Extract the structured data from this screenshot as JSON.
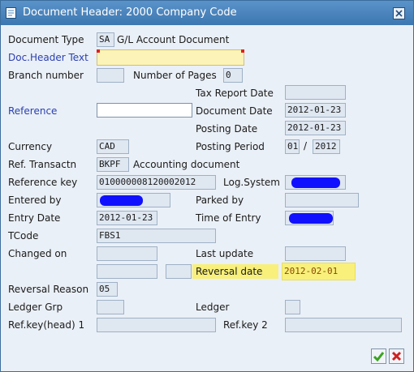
{
  "window": {
    "title": "Document Header: 2000 Company Code"
  },
  "fields": {
    "document_type": {
      "label": "Document Type",
      "code": "SA",
      "text": "G/L Account Document"
    },
    "doc_header_text": {
      "label": "Doc.Header Text",
      "value": ""
    },
    "branch_number": {
      "label": "Branch number",
      "value": ""
    },
    "number_of_pages": {
      "label": "Number of Pages",
      "value": "0"
    },
    "tax_report_date": {
      "label": "Tax Report Date",
      "value": ""
    },
    "reference": {
      "label": "Reference",
      "value": ""
    },
    "document_date": {
      "label": "Document Date",
      "value": "2012-01-23"
    },
    "posting_date": {
      "label": "Posting Date",
      "value": "2012-01-23"
    },
    "currency": {
      "label": "Currency",
      "value": "CAD"
    },
    "posting_period": {
      "label": "Posting Period",
      "period": "01",
      "separator": "/",
      "year": "2012"
    },
    "ref_transaction": {
      "label": "Ref. Transactn",
      "value": "BKPF",
      "text": "Accounting document"
    },
    "reference_key": {
      "label": "Reference key",
      "value": "010000008120002012"
    },
    "log_system": {
      "label": "Log.System",
      "value": ""
    },
    "entered_by": {
      "label": "Entered by",
      "value": ""
    },
    "parked_by": {
      "label": "Parked by",
      "value": ""
    },
    "entry_date": {
      "label": "Entry Date",
      "value": "2012-01-23"
    },
    "time_of_entry": {
      "label": "Time of Entry",
      "value": ""
    },
    "tcode": {
      "label": "TCode",
      "value": "FBS1"
    },
    "changed_on": {
      "label": "Changed on",
      "value": ""
    },
    "last_update": {
      "label": "Last update",
      "value": ""
    },
    "reversal_date": {
      "label": "Reversal date",
      "value": "2012-02-01"
    },
    "reversal_reason": {
      "label": "Reversal Reason",
      "value": "05"
    },
    "ledger_grp": {
      "label": "Ledger Grp",
      "value": ""
    },
    "ledger": {
      "label": "Ledger",
      "value": ""
    },
    "ref_key_head_1": {
      "label": "Ref.key(head) 1",
      "value": ""
    },
    "ref_key_2": {
      "label": "Ref.key 2",
      "value": ""
    }
  },
  "colors": {
    "titlebar": "#4a86c0",
    "label_link": "#2a3fb0",
    "highlight": "#f8f07a",
    "redaction": "#1010ff",
    "ok_green": "#3aa31e",
    "cancel_red": "#d02020"
  },
  "icons": {
    "title": "document-icon",
    "close": "close-icon",
    "ok": "checkmark-icon",
    "cancel": "cancel-icon"
  }
}
